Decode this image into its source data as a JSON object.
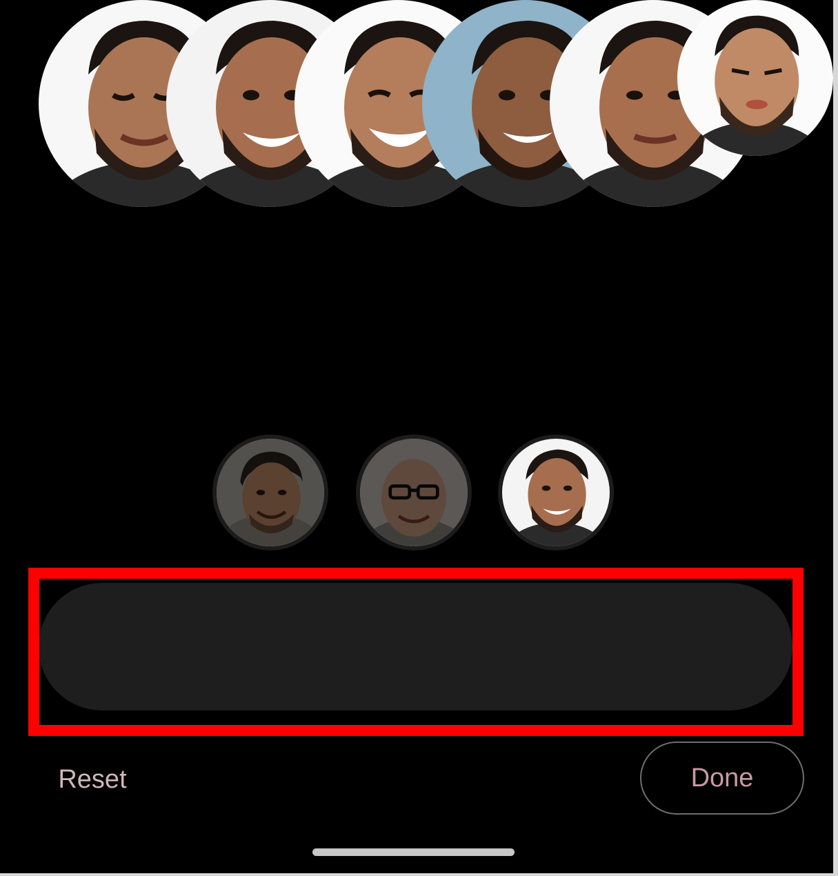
{
  "people": [
    {
      "name_icon": "person-face-1",
      "state": "dimmed"
    },
    {
      "name_icon": "person-face-2",
      "state": "dimmed"
    },
    {
      "name_icon": "person-face-3",
      "state": "active"
    }
  ],
  "expressions": [
    {
      "icon": "face-eyes-closed",
      "selected": false
    },
    {
      "icon": "face-big-smile",
      "selected": true
    },
    {
      "icon": "face-laughing",
      "selected": false
    },
    {
      "icon": "face-smile-blue-bg",
      "selected": false
    },
    {
      "icon": "face-neutral-smile",
      "selected": false
    },
    {
      "icon": "face-squint",
      "selected": false
    }
  ],
  "actions": {
    "reset_label": "Reset",
    "done_label": "Done"
  },
  "colors": {
    "background": "#000000",
    "strip": "#1e1e1e",
    "highlight": "#ff0000",
    "reset_text": "#d0b7ba",
    "done_text": "#c99aa6",
    "selected_ring": "#5f6f9f"
  }
}
